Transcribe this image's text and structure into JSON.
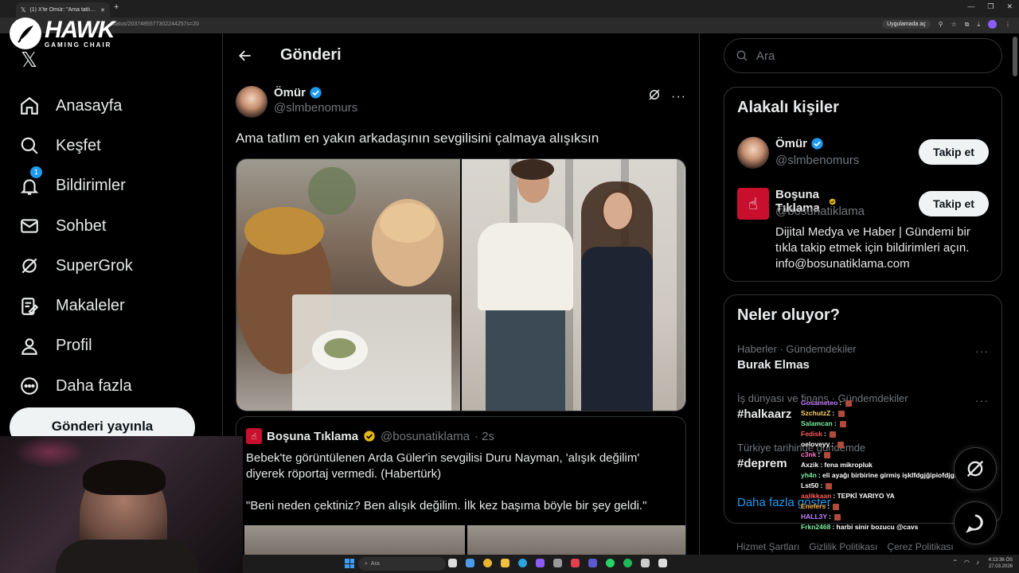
{
  "browser": {
    "tab_title": "(1) X'te Ömür: \"Ama tatlım en y",
    "url": "/status/2037485577302244257s=20",
    "app_button": "Uygulamada aç"
  },
  "overlay_brand": {
    "name": "HAWK",
    "sub": "GAMING CHAIR"
  },
  "sidebar": {
    "items": [
      {
        "label": "Anasayfa",
        "icon": "home-icon"
      },
      {
        "label": "Keşfet",
        "icon": "search-icon"
      },
      {
        "label": "Bildirimler",
        "icon": "bell-icon",
        "badge": "1"
      },
      {
        "label": "Sohbet",
        "icon": "mail-icon"
      },
      {
        "label": "SuperGrok",
        "icon": "grok-icon"
      },
      {
        "label": "Makaleler",
        "icon": "article-icon"
      },
      {
        "label": "Profil",
        "icon": "person-icon"
      },
      {
        "label": "Daha fazla",
        "icon": "more-circle-icon"
      }
    ],
    "post_button": "Gönderi yayınla"
  },
  "main": {
    "title": "Gönderi",
    "post": {
      "author_name": "Ömür",
      "author_handle": "@slmbenomurs",
      "text": "Ama tatlım en yakın arkadaşının sevgilisini çalmaya alışıksın"
    },
    "quote": {
      "name": "Boşuna Tıklama",
      "handle": "@bosunatiklama",
      "time": "· 2s",
      "text1": "Bebek'te görüntülenen Arda Güler'in sevgilisi Duru Nayman, 'alışık değilim' diyerek röportaj vermedi. (Habertürk)",
      "text2": "\"Beni neden çektiniz? Ben alışık değilim. İlk kez başıma böyle bir şey geldi.\""
    }
  },
  "right": {
    "search_placeholder": "Ara",
    "related": {
      "title": "Alakalı kişiler",
      "people": [
        {
          "name": "Ömür",
          "handle": "@slmbenomurs",
          "button": "Takip et"
        },
        {
          "name": "Boşuna Tıklama",
          "handle": "@bosunatiklama",
          "button": "Takip et",
          "bio": "Dijital Medya ve Haber | Gündemi bir tıkla takip etmek için bildirimleri açın. info@bosunatiklama.com"
        }
      ]
    },
    "trends": {
      "title": "Neler oluyor?",
      "items": [
        {
          "meta": "Haberler · Gündemdekiler",
          "title": "Burak Elmas"
        },
        {
          "meta": "İş dünyası ve finans · Gündemdekiler",
          "title": "#halkaarz"
        },
        {
          "meta": "Türkiye tarihinde gündemde",
          "title": "#deprem"
        }
      ],
      "show_more": "Daha fazla göster"
    },
    "footer": [
      "Hizmet Şartları",
      "Gizlilik Politikası",
      "Çerez Politikası"
    ]
  },
  "chat": [
    {
      "user": "Gosameteo",
      "color": "#c77dff",
      "msg": ""
    },
    {
      "user": "SzchutzZ",
      "color": "#ffd166",
      "msg": ""
    },
    {
      "user": "Salamcan",
      "color": "#7cf0a0",
      "msg": ""
    },
    {
      "user": "Fedisk",
      "color": "#ff5a5a",
      "msg": ""
    },
    {
      "user": "oeloveyy",
      "color": "#ffffff",
      "msg": ""
    },
    {
      "user": "c3nk",
      "color": "#ff77cc",
      "msg": ""
    },
    {
      "user": "Axzik",
      "color": "#ffffff",
      "msg": "fena mikropluk"
    },
    {
      "user": "yh4n",
      "color": "#7cf0a0",
      "msg": "eli ayağı birbirine girmiş işklfdgjğipiofdjgf"
    },
    {
      "user": "Lst50",
      "color": "#ffffff",
      "msg": ""
    },
    {
      "user": "aalikkaan",
      "color": "#ff5a5a",
      "msg": "TEPKİ YARIYO YA"
    },
    {
      "user": "Enefers",
      "color": "#ffb347",
      "msg": ""
    },
    {
      "user": "HALL3Y",
      "color": "#c77dff",
      "msg": ""
    },
    {
      "user": "Frkn2468",
      "color": "#7cf0a0",
      "msg": "harbi sinir bozucu @cavs"
    }
  ],
  "taskbar": {
    "search_placeholder": "Ara",
    "time": "4:13:36 ÖS",
    "date": "27.03.2026"
  }
}
